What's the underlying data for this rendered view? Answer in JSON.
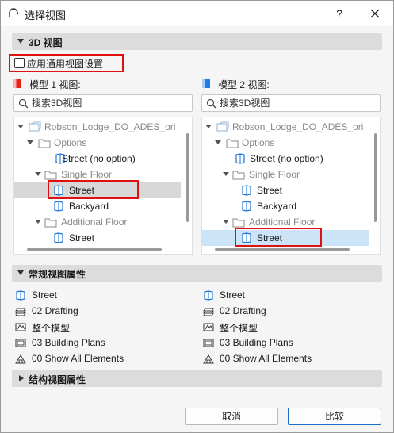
{
  "window": {
    "title": "选择视图",
    "help": "?",
    "close": "×"
  },
  "sections": {
    "view3d": "3D 视图",
    "general": "常规视图属性",
    "structure": "结构视图属性"
  },
  "apply_common": {
    "label": "应用通用视图设置",
    "checked": false
  },
  "model1": {
    "label": "模型 1 视图:",
    "color": "#e8231b",
    "search_placeholder": "搜索3D视图",
    "tree": [
      {
        "label": "Robson_Lodge_DO_ADES_ori",
        "muted": true
      },
      {
        "label": "Options",
        "muted": true
      },
      {
        "label": "Street (no option)",
        "muted": false
      },
      {
        "label": "Single Floor",
        "muted": true
      },
      {
        "label": "Street",
        "muted": false,
        "selected": true
      },
      {
        "label": "Backyard",
        "muted": false
      },
      {
        "label": "Additional Floor",
        "muted": true
      },
      {
        "label": "Street",
        "muted": false
      }
    ]
  },
  "model2": {
    "label": "模型 2 视图:",
    "color": "#1e7be8",
    "search_placeholder": "搜索3D视图",
    "tree": [
      {
        "label": "Robson_Lodge_DO_ADES_ori",
        "muted": true
      },
      {
        "label": "Options",
        "muted": true
      },
      {
        "label": "Street (no option)",
        "muted": false
      },
      {
        "label": "Single Floor",
        "muted": true
      },
      {
        "label": "Street",
        "muted": false
      },
      {
        "label": "Backyard",
        "muted": false
      },
      {
        "label": "Additional Floor",
        "muted": true
      },
      {
        "label": "Street",
        "muted": false,
        "selected": true
      }
    ]
  },
  "properties": {
    "left": [
      "Street",
      "02 Drafting",
      "整个模型",
      "03 Building Plans",
      "00 Show All Elements"
    ],
    "right": [
      "Street",
      "02 Drafting",
      "整个模型",
      "03 Building Plans",
      "00 Show All Elements"
    ],
    "icons": [
      "view-3d-icon",
      "layer-combo-icon",
      "model-filter-icon",
      "plan-icon",
      "renovation-filter-icon"
    ]
  },
  "buttons": {
    "cancel": "取消",
    "compare": "比较"
  },
  "colors": {
    "highlight_red": "#e01010",
    "selection_blue": "#cce4f7",
    "selection_gray": "#d8d8d8",
    "primary_border": "#1c6fc9"
  }
}
